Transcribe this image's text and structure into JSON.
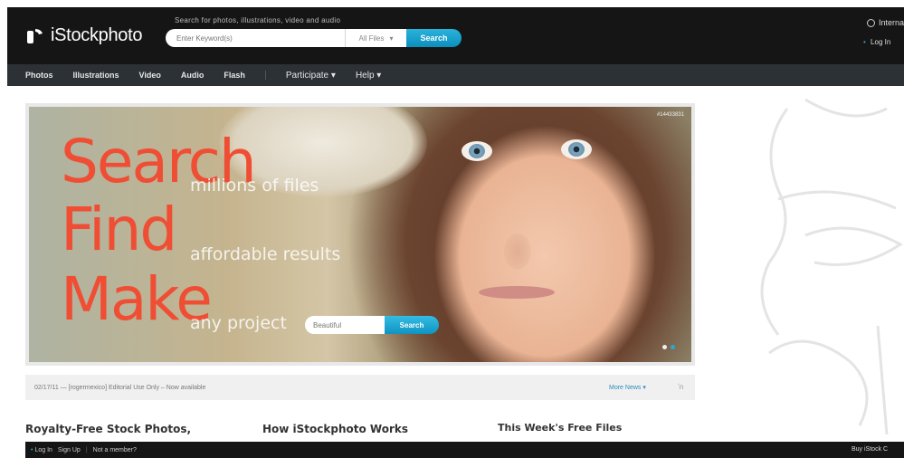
{
  "header": {
    "logo_text": "iStockphoto",
    "tagline": "Search for photos, illustrations, video and audio",
    "search": {
      "placeholder": "Enter Keyword(s)",
      "filter_value": "All Files",
      "button_label": "Search"
    },
    "international_label": "Interna",
    "login_label": "Log In"
  },
  "nav": {
    "items": [
      "Photos",
      "Illustrations",
      "Video",
      "Audio",
      "Flash"
    ],
    "dropdowns": [
      "Participate",
      "Help"
    ]
  },
  "hero": {
    "words": [
      "Search",
      "Find",
      "Make"
    ],
    "subtexts": [
      "millions of files",
      "affordable results",
      "any project"
    ],
    "search_value": "Beautiful",
    "search_button": "Search",
    "image_id": "#14433831",
    "slide_count": 2,
    "active_slide": 2
  },
  "news": {
    "text": "02/17/11 — [rogermexico] Editorial Use Only – Now available",
    "more_label": "More News",
    "rss_icon": "rss-icon"
  },
  "sections": {
    "royalty_free": "Royalty-Free Stock Photos,",
    "how_it_works": "How iStockphoto Works",
    "free_files": "This Week's Free Files"
  },
  "footer": {
    "login": "Log In",
    "signup": "Sign Up",
    "not_member": "Not a member?",
    "buy": "Buy iStock C"
  },
  "colors": {
    "header_bg": "#151515",
    "nav_bg": "#2b3134",
    "accent_blue": "#1a9fd0",
    "hero_text": "#ef4e34"
  }
}
